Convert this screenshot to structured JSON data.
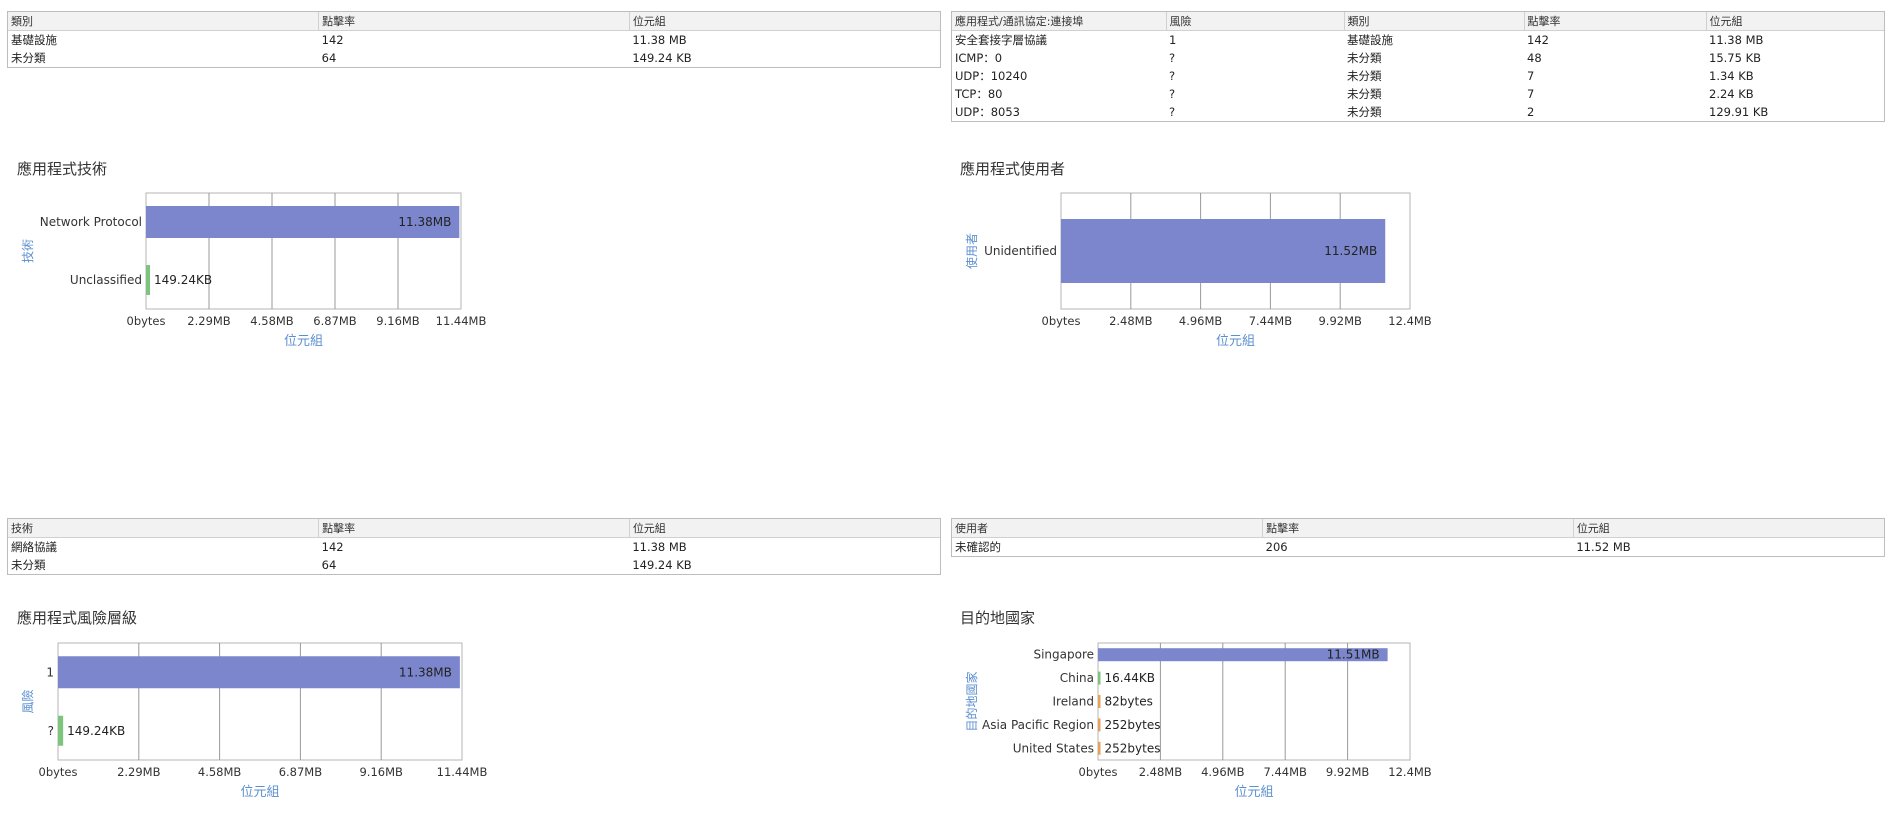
{
  "tables": {
    "category": {
      "headers": [
        "類別",
        "點擊率",
        "位元組"
      ],
      "rows": [
        [
          "基礎設施",
          "142",
          "11.38 MB"
        ],
        [
          "未分類",
          "64",
          "149.24 KB"
        ]
      ]
    },
    "app_ports": {
      "headers": [
        "應用程式/通訊協定:連接埠",
        "風險",
        "類別",
        "點擊率",
        "位元組"
      ],
      "rows": [
        [
          "安全套接字層協議",
          "1",
          "基礎設施",
          "142",
          "11.38 MB"
        ],
        [
          "ICMP：0",
          "?",
          "未分類",
          "48",
          "15.75 KB"
        ],
        [
          "UDP：10240",
          "?",
          "未分類",
          "7",
          "1.34 KB"
        ],
        [
          "TCP：80",
          "?",
          "未分類",
          "7",
          "2.24 KB"
        ],
        [
          "UDP：8053",
          "?",
          "未分類",
          "2",
          "129.91 KB"
        ]
      ]
    },
    "technology": {
      "headers": [
        "技術",
        "點擊率",
        "位元組"
      ],
      "rows": [
        [
          "網絡協議",
          "142",
          "11.38 MB"
        ],
        [
          "未分類",
          "64",
          "149.24 KB"
        ]
      ]
    },
    "users": {
      "headers": [
        "使用者",
        "點擊率",
        "位元組"
      ],
      "rows": [
        [
          "未確認的",
          "206",
          "11.52 MB"
        ]
      ]
    }
  },
  "colors": {
    "bar_primary": "#7b86cc",
    "bar_secondary": "#7dc47d",
    "bar_tertiary": "#e6a25a",
    "axis_title": "#5b8fd0",
    "grid": "#999999"
  },
  "chart_data": [
    {
      "id": "tech",
      "type": "bar",
      "orientation": "horizontal",
      "title": "應用程式技術",
      "xlabel": "位元組",
      "ylabel": "技術",
      "categories": [
        "Network Protocol",
        "Unclassified"
      ],
      "values": [
        11.38,
        0.14574
      ],
      "value_labels": [
        "11.38MB",
        "149.24KB"
      ],
      "xlim": [
        0,
        11.44
      ],
      "xticks": [
        "0bytes",
        "2.29MB",
        "4.58MB",
        "6.87MB",
        "9.16MB",
        "11.44MB"
      ],
      "grid": true
    },
    {
      "id": "users",
      "type": "bar",
      "orientation": "horizontal",
      "title": "應用程式使用者",
      "xlabel": "位元組",
      "ylabel": "使用者",
      "categories": [
        "Unidentified"
      ],
      "values": [
        11.52
      ],
      "value_labels": [
        "11.52MB"
      ],
      "xlim": [
        0,
        12.4
      ],
      "xticks": [
        "0bytes",
        "2.48MB",
        "4.96MB",
        "7.44MB",
        "9.92MB",
        "12.4MB"
      ],
      "grid": true
    },
    {
      "id": "risk",
      "type": "bar",
      "orientation": "horizontal",
      "title": "應用程式風險層級",
      "xlabel": "位元組",
      "ylabel": "風險",
      "categories": [
        "1",
        "?"
      ],
      "values": [
        11.38,
        0.14574
      ],
      "value_labels": [
        "11.38MB",
        "149.24KB"
      ],
      "xlim": [
        0,
        11.44
      ],
      "xticks": [
        "0bytes",
        "2.29MB",
        "4.58MB",
        "6.87MB",
        "9.16MB",
        "11.44MB"
      ],
      "grid": true
    },
    {
      "id": "country",
      "type": "bar",
      "orientation": "horizontal",
      "title": "目的地國家",
      "xlabel": "位元組",
      "ylabel": "目的地國家",
      "categories": [
        "Singapore",
        "China",
        "Ireland",
        "Asia Pacific Region",
        "United States"
      ],
      "values": [
        11.51,
        0.01605,
        8e-08,
        2.4e-07,
        2.4e-07
      ],
      "value_labels": [
        "11.51MB",
        "16.44KB",
        "82bytes",
        "252bytes",
        "252bytes"
      ],
      "xlim": [
        0,
        12.4
      ],
      "xticks": [
        "0bytes",
        "2.48MB",
        "4.96MB",
        "7.44MB",
        "9.92MB",
        "12.4MB"
      ],
      "grid": true
    }
  ]
}
